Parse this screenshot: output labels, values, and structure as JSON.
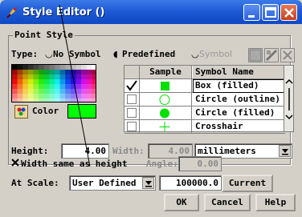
{
  "window": {
    "title": "Style Editor ()"
  },
  "point_style": {
    "group_label": "Point Style",
    "type_label": "Type:",
    "type_options": [
      "No Symbol",
      "Predefined",
      "Symbol"
    ],
    "selected_type": "Predefined"
  },
  "color": {
    "label": "Color",
    "value": "#00ff00"
  },
  "symbols": {
    "columns": [
      "Sample",
      "Symbol Name"
    ],
    "rows": [
      {
        "name": "Box (filled)",
        "sample": "box-filled",
        "checked": true
      },
      {
        "name": "Circle (outline)",
        "sample": "circle-outline",
        "checked": false
      },
      {
        "name": "Circle (filled)",
        "sample": "circle-filled",
        "checked": false
      },
      {
        "name": "Crosshair (simple",
        "sample": "crosshair",
        "checked": false
      }
    ]
  },
  "size": {
    "height_label": "Height:",
    "height_value": "4.00",
    "width_label": "Width:",
    "width_value": "4.00",
    "units": "millimeters",
    "same_width_label": "Width same as height",
    "same_width_checked": true,
    "angle_label": "Angle:",
    "angle_value": "0.00"
  },
  "scale": {
    "label": "At Scale:",
    "mode": "User Defined",
    "value": "100000.0",
    "current_label": "Current"
  },
  "buttons": {
    "ok": "OK",
    "cancel": "Cancel",
    "help": "Help"
  }
}
